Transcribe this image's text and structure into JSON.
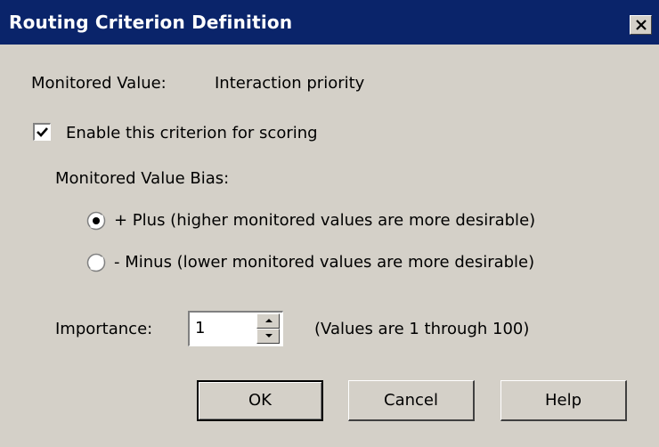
{
  "window": {
    "title": "Routing Criterion Definition",
    "title_bar_color": "#0a246a",
    "background_color": "#d4d0c8",
    "close_icon": "close-icon"
  },
  "monitored": {
    "label": "Monitored Value:",
    "value": "Interaction priority"
  },
  "enable_checkbox": {
    "label": "Enable this criterion for scoring",
    "checked": true
  },
  "bias": {
    "label": "Monitored Value Bias:",
    "options": [
      {
        "label": "+ Plus (higher monitored values are more desirable)",
        "selected": true
      },
      {
        "label": "- Minus (lower monitored values are more desirable)",
        "selected": false
      }
    ]
  },
  "importance": {
    "label": "Importance:",
    "value": "1",
    "hint": "(Values are 1 through 100)"
  },
  "buttons": {
    "ok": "OK",
    "cancel": "Cancel",
    "help": "Help"
  }
}
